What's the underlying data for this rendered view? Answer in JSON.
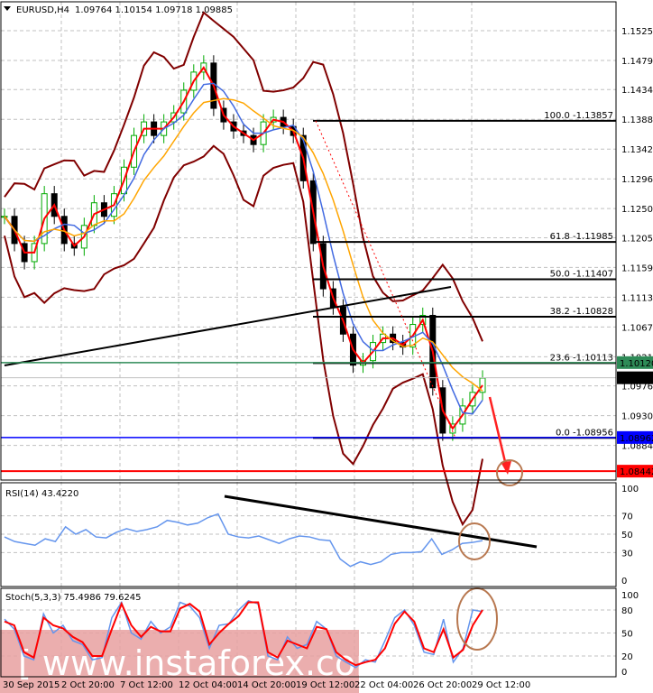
{
  "header": {
    "symbol": "EURUSD,H4",
    "ohlc": "1.09764 1.10154 1.09718 1.09885"
  },
  "chart_data": [
    {
      "type": "candlestick",
      "title": "EURUSD,H4",
      "x_tick_labels": [
        "30 Sep 2015",
        "2 Oct 20:00",
        "7 Oct 12:00",
        "12 Oct 04:00",
        "14 Oct 20:00",
        "19 Oct 12:00",
        "22 Oct 04:00",
        "26 Oct 20:00",
        "29 Oct 12:00"
      ],
      "y_tick_labels": [
        "1.15250",
        "1.14790",
        "1.14340",
        "1.13880",
        "1.13420",
        "1.12960",
        "1.12500",
        "1.12050",
        "1.11590",
        "1.11130",
        "1.10670",
        "1.10210",
        "1.09760",
        "1.09300",
        "1.08840"
      ],
      "ylim": [
        1.0835,
        1.157
      ],
      "grid": true,
      "close": [
        1.1238,
        1.1196,
        1.1168,
        1.1196,
        1.1273,
        1.1238,
        1.1196,
        1.1189,
        1.1224,
        1.1259,
        1.1238,
        1.1273,
        1.1314,
        1.1363,
        1.1384,
        1.1363,
        1.1384,
        1.1398,
        1.1433,
        1.1461,
        1.1475,
        1.1405,
        1.1384,
        1.137,
        1.1363,
        1.1349,
        1.1384,
        1.1391,
        1.1377,
        1.1363,
        1.1293,
        1.1196,
        1.1126,
        1.1098,
        1.1056,
        1.1008,
        1.1015,
        1.1043,
        1.1056,
        1.1043,
        1.1036,
        1.1071,
        1.1085,
        1.0973,
        1.0903,
        1.0917,
        1.0945,
        1.0966,
        1.0988
      ],
      "fibonacci": [
        {
          "label": "100.0 -1.13857",
          "price": 1.13857
        },
        {
          "label": "61.8 -1.11985",
          "price": 1.11985
        },
        {
          "label": "50.0 -1.11407",
          "price": 1.11407
        },
        {
          "label": "38.2 -1.10828",
          "price": 1.10828
        },
        {
          "label": "23.6 -1.10113",
          "price": 1.10113
        },
        {
          "label": "0.0 -1.08956",
          "price": 1.08956
        }
      ],
      "price_tags": [
        {
          "text": "1.10120",
          "price": 1.1012,
          "color": "#2e8b57"
        },
        {
          "text": "1.09885",
          "price": 1.09885,
          "color": "#000000"
        },
        {
          "text": "1.08962",
          "price": 1.08962,
          "color": "#0000ff"
        },
        {
          "text": "1.08442",
          "price": 1.08442,
          "color": "#ff0000"
        }
      ],
      "colors": {
        "bull": "#00aa00",
        "bear": "#000000",
        "ma_fast": "#ff0000",
        "ma_mid": "#4169e1",
        "ma_slow": "#ffa500",
        "bands": "#800000"
      }
    },
    {
      "type": "line",
      "title": "RSI(14) 43.4220",
      "y_tick_labels": [
        "100",
        "70",
        "50",
        "30",
        "0"
      ],
      "ylim": [
        0,
        100
      ],
      "values": [
        47,
        42,
        40,
        38,
        45,
        42,
        58,
        50,
        55,
        47,
        46,
        52,
        56,
        53,
        55,
        58,
        65,
        63,
        60,
        62,
        68,
        72,
        50,
        47,
        46,
        48,
        44,
        40,
        45,
        48,
        47,
        44,
        43,
        23,
        15,
        20,
        17,
        20,
        28,
        30,
        30,
        31,
        45,
        28,
        33,
        40,
        41,
        43
      ],
      "color": "#6495ed"
    },
    {
      "type": "line",
      "title": "Stoch(5,3,3) 75.4986 79.6245",
      "y_tick_labels": [
        "100",
        "80",
        "50",
        "20",
        "0"
      ],
      "ylim": [
        0,
        100
      ],
      "series": [
        {
          "color": "#6495ed",
          "values": [
            68,
            55,
            20,
            15,
            75,
            50,
            60,
            40,
            35,
            15,
            18,
            70,
            90,
            50,
            42,
            65,
            50,
            58,
            90,
            85,
            70,
            30,
            60,
            62,
            80,
            92,
            88,
            20,
            15,
            45,
            30,
            35,
            65,
            55,
            20,
            12,
            5,
            15,
            12,
            40,
            70,
            80,
            60,
            25,
            22,
            68,
            12,
            30,
            80,
            78
          ]
        },
        {
          "color": "#ff0000",
          "values": [
            65,
            60,
            25,
            18,
            70,
            60,
            56,
            45,
            38,
            20,
            20,
            55,
            88,
            60,
            45,
            58,
            52,
            52,
            82,
            88,
            78,
            35,
            50,
            62,
            72,
            90,
            90,
            25,
            18,
            40,
            35,
            30,
            58,
            55,
            25,
            15,
            8,
            12,
            15,
            30,
            62,
            78,
            65,
            30,
            25,
            55,
            18,
            28,
            60,
            80
          ]
        }
      ]
    }
  ],
  "annotations": {
    "watermark": "[ www.instaforex.com ]"
  }
}
